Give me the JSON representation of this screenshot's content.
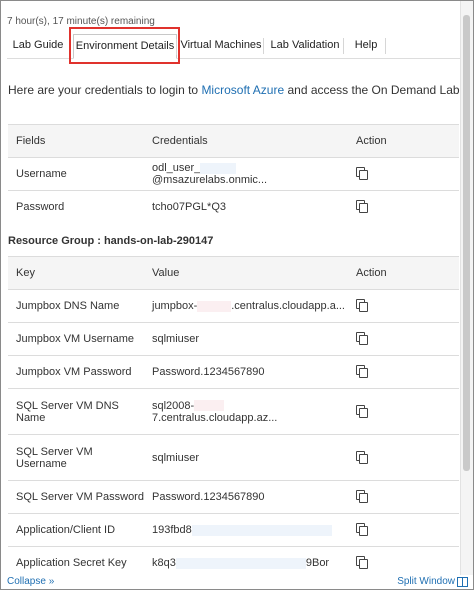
{
  "timer": "7 hour(s), 17 minute(s) remaining",
  "tabs": [
    {
      "label": "Lab Guide"
    },
    {
      "label": "Environment Details"
    },
    {
      "label": "Virtual Machines"
    },
    {
      "label": "Lab Validation"
    },
    {
      "label": "Help"
    }
  ],
  "intro": {
    "prefix": "Here are your credentials to login to ",
    "link": "Microsoft Azure",
    "suffix": " and access the On Demand Lab."
  },
  "credentials": {
    "headers": {
      "col1": "Fields",
      "col2": "Credentials",
      "col3": "Action"
    },
    "rows": [
      {
        "field": "Username",
        "value_start": "odl_user_",
        "value_end": "@msazurelabs.onmic..."
      },
      {
        "field": "Password",
        "value": "tcho07PGL*Q3"
      }
    ]
  },
  "resource_group": "Resource Group : hands-on-lab-290147",
  "resources": {
    "headers": {
      "col1": "Key",
      "col2": "Value",
      "col3": "Action"
    },
    "rows": [
      {
        "key": "Jumpbox DNS Name",
        "value_start": "jumpbox-",
        "value_end": ".centralus.cloudapp.a..."
      },
      {
        "key": "Jumpbox VM Username",
        "value": "sqlmiuser"
      },
      {
        "key": "Jumpbox VM Password",
        "value": "Password.1234567890"
      },
      {
        "key": "SQL Server VM DNS Name",
        "value_start": "sql2008-",
        "value_end": "7.centralus.cloudapp.az..."
      },
      {
        "key": "SQL Server VM Username",
        "value": "sqlmiuser"
      },
      {
        "key": "SQL Server VM Password",
        "value": "Password.1234567890"
      },
      {
        "key": "Application/Client ID",
        "value": "193fbd8"
      },
      {
        "key": "Application Secret Key",
        "value_start": "k8q3",
        "value_end": "9Bor"
      }
    ]
  },
  "footer": {
    "collapse": "Collapse »",
    "split": "Split Window"
  }
}
